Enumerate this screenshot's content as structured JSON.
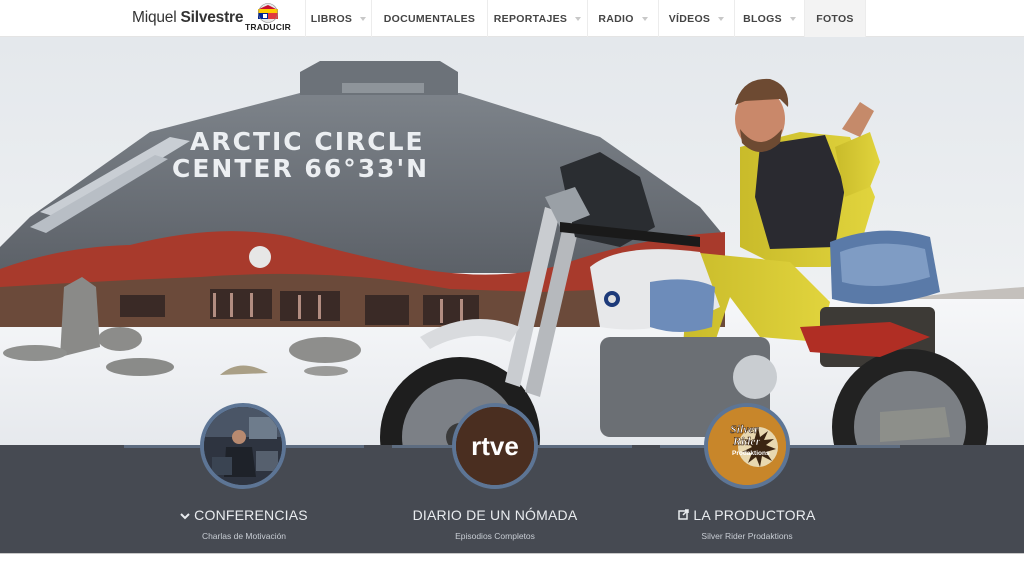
{
  "brand": {
    "first": "Miquel",
    "last": "Silvestre"
  },
  "translate": {
    "label": "TRADUCIR"
  },
  "nav": {
    "items": [
      {
        "label": "LIBROS",
        "has_dropdown": true
      },
      {
        "label": "DOCUMENTALES",
        "has_dropdown": false
      },
      {
        "label": "REPORTAJES",
        "has_dropdown": true
      },
      {
        "label": "RADIO",
        "has_dropdown": true
      },
      {
        "label": "VÍDEOS",
        "has_dropdown": true
      },
      {
        "label": "BLOGS",
        "has_dropdown": true
      },
      {
        "label": "FOTOS",
        "has_dropdown": false,
        "active": true
      }
    ]
  },
  "hero": {
    "building_sign_line1": "ARCTIC CIRCLE",
    "building_sign_line2": "CENTER 66°33'N"
  },
  "features": [
    {
      "title": "CONFERENCIAS",
      "subtitle": "Charlas de Motivación",
      "icon": "chevron-down-icon"
    },
    {
      "title": "DIARIO DE UN NÓMADA",
      "subtitle": "Episodios Completos",
      "logo_text": "rtve"
    },
    {
      "title": "LA PRODUCTORA",
      "subtitle": "Silver Rider Prodaktions",
      "icon": "external-link-icon",
      "logo_line1": "Silver",
      "logo_line2": "Rider",
      "logo_line3": "Prodaktions"
    }
  ],
  "colors": {
    "panel": "#464a52",
    "panel_accent": "#5d6c80",
    "circle_border": "#5d7595"
  }
}
